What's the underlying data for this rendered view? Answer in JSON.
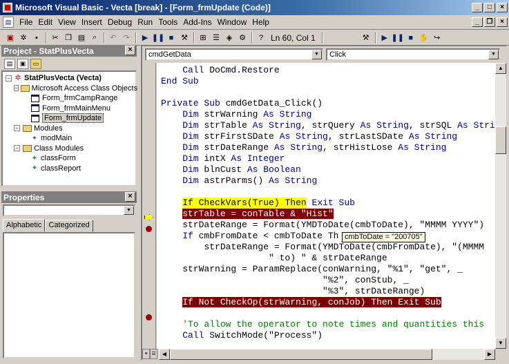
{
  "window": {
    "title": "Microsoft Visual Basic - Vecta [break] - [Form_frmUpdate (Code)]",
    "min": "_",
    "max": "□",
    "close": "×"
  },
  "menu": {
    "items": [
      "File",
      "Edit",
      "View",
      "Insert",
      "Debug",
      "Run",
      "Tools",
      "Add-Ins",
      "Window",
      "Help"
    ]
  },
  "toolbar": {
    "position": "Ln 60, Col 1"
  },
  "project": {
    "title": "Project - StatPlusVecta",
    "root": "StatPlusVecta (Vecta)",
    "folder1": "Microsoft Access Class Objects",
    "forms": [
      "Form_frmCampRange",
      "Form_frmMainMenu",
      "Form_frmUpdate"
    ],
    "folder2": "Modules",
    "modules": [
      "modMain"
    ],
    "folder3": "Class Modules",
    "classes": [
      "classForm",
      "classReport"
    ]
  },
  "properties": {
    "title": "Properties",
    "tab_alpha": "Alphabetic",
    "tab_cat": "Categorized"
  },
  "code": {
    "object": "cmdGetData",
    "procedure": "Click",
    "tooltip": "cmbToDate = \"200705\"",
    "lines": [
      "    Call DoCmd.Restore",
      "End Sub",
      "",
      "Private Sub cmdGetData_Click()",
      "    Dim strWarning As String",
      "    Dim strTable As String, strQuery As String, strSQL As String",
      "    Dim strFirstSDate As String, strLastSDate As String",
      "    Dim strDateRange As String, strHistLose As String",
      "    Dim intX As Integer",
      "    Dim blnCust As Boolean",
      "    Dim astrParms() As String",
      "",
      "    If CheckVars(True) Then Exit Sub",
      "    strTable = conTable & \"Hist\"",
      "    strDateRange = Format(YMDToDate(cmbToDate), \"MMMM YYYY\")",
      "    If cmbFromDate < cmbToDate Then",
      "        strDateRange = Format(YMDToDate(cmbFromDate), \"(MMMM",
      "                    \" to) \" & strDateRange",
      "    strWarning = ParamReplace(conWarning, \"%1\", \"get\", _",
      "                              \"%2\", conStub, _",
      "                              \"%3\", strDateRange)",
      "    If Not CheckOp(strWarning, conJob) Then Exit Sub",
      "",
      "    'To allow the operator to note times and quantities this",
      "    Call SwitchMode(\"Process\")"
    ]
  }
}
